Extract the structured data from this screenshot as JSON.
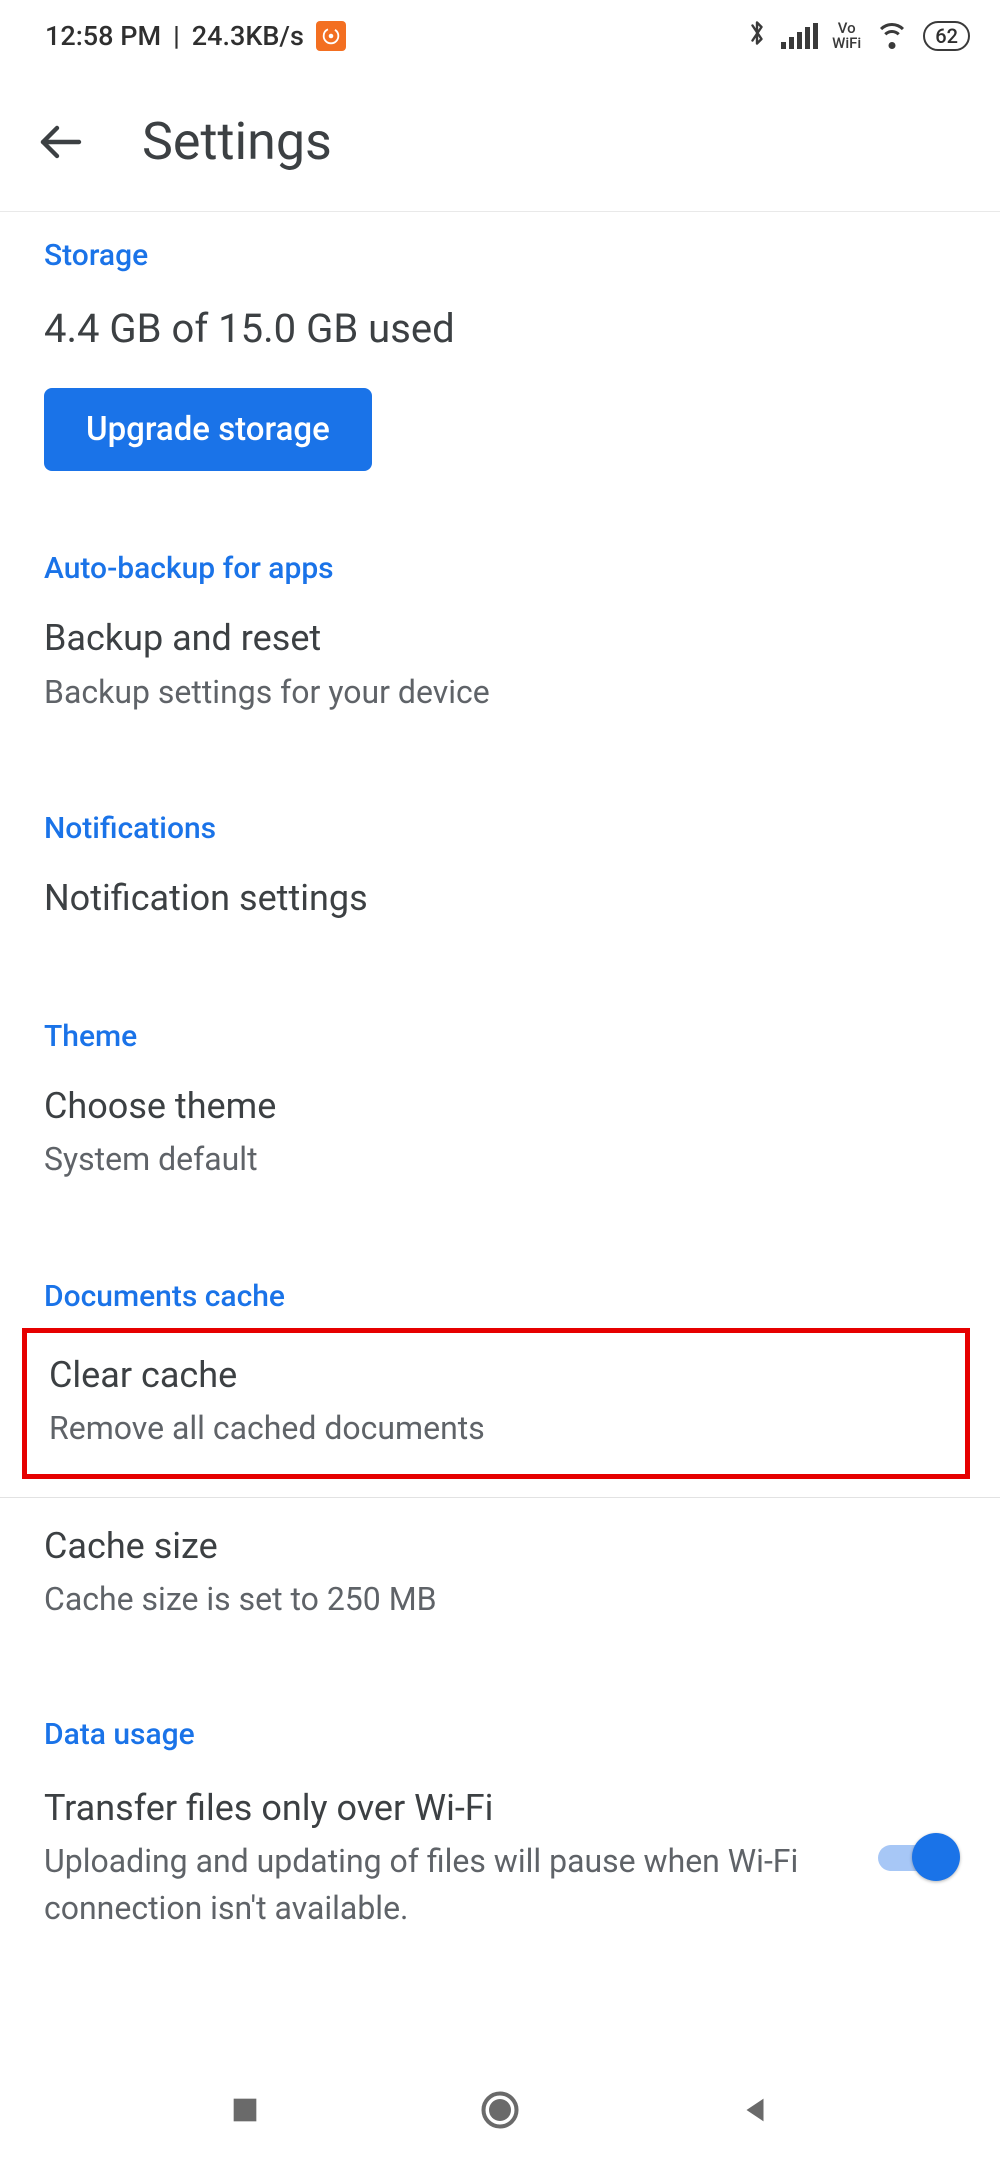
{
  "status": {
    "time": "12:58 PM",
    "net_speed": "24.3KB/s",
    "vo_top": "Vo",
    "vo_bottom": "WiFi",
    "battery": "62"
  },
  "appbar": {
    "title": "Settings"
  },
  "sections": {
    "storage": {
      "header": "Storage",
      "usage": "4.4 GB of 15.0 GB used",
      "upgrade_label": "Upgrade storage"
    },
    "autobackup": {
      "header": "Auto-backup for apps",
      "item_title": "Backup and reset",
      "item_sub": "Backup settings for your device"
    },
    "notifications": {
      "header": "Notifications",
      "item_title": "Notification settings"
    },
    "theme": {
      "header": "Theme",
      "item_title": "Choose theme",
      "item_sub": "System default"
    },
    "cache": {
      "header": "Documents cache",
      "clear_title": "Clear cache",
      "clear_sub": "Remove all cached documents",
      "size_title": "Cache size",
      "size_sub": "Cache size is set to 250 MB"
    },
    "data": {
      "header": "Data usage",
      "wifi_title": "Transfer files only over Wi-Fi",
      "wifi_sub": "Uploading and updating of files will pause when Wi-Fi connection isn't available.",
      "wifi_on": true
    }
  }
}
